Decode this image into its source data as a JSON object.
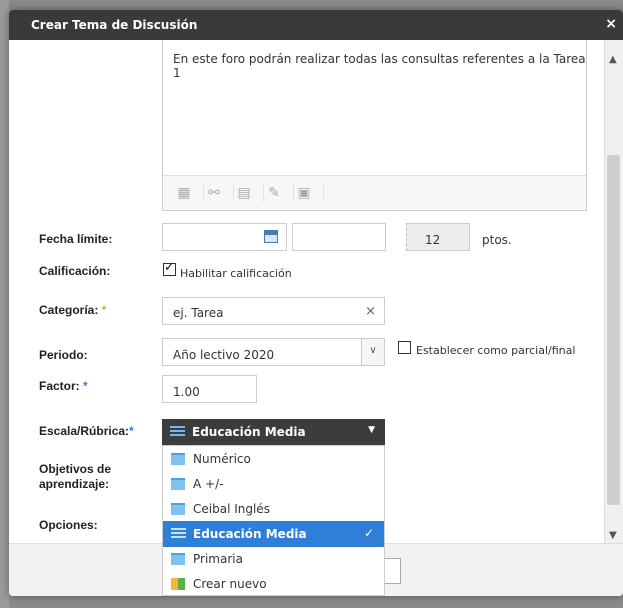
{
  "dialog": {
    "title": "Crear Tema de Discusión",
    "close_glyph": "×"
  },
  "editor": {
    "text": "En este foro podrán realizar todas las consultas referentes a la Tarea 1",
    "toolbar_icons": [
      "table-icon",
      "link-icon",
      "media-icon",
      "pen-icon",
      "embed-icon"
    ]
  },
  "form": {
    "fecha_limite": {
      "label": "Fecha límite:",
      "date_value": "",
      "time_value": "",
      "points_value": "12",
      "points_unit": "ptos."
    },
    "calificacion": {
      "label": "Calificación:",
      "checkbox_label": "Habilitar calificación",
      "checked": true
    },
    "categoria": {
      "label": "Categoría:",
      "required_mark": "*",
      "placeholder": "ej. Tarea",
      "clear_glyph": "×"
    },
    "periodo": {
      "label": "Periodo:",
      "value": "Año lectivo 2020",
      "parcial_label": "Establecer como parcial/final",
      "parcial_checked": false
    },
    "factor": {
      "label": "Factor:",
      "required_mark": "*",
      "value": "1.00"
    },
    "escala": {
      "label": "Escala/Rúbrica:",
      "required_mark": "*",
      "value": "Educación Media"
    },
    "objetivos": {
      "label": "Objetivos de aprendizaje:"
    },
    "opciones": {
      "label": "Opciones:"
    }
  },
  "dropdown": {
    "items": [
      {
        "label": "Numérico",
        "selected": false
      },
      {
        "label": "A +/-",
        "selected": false
      },
      {
        "label": "Ceibal Inglés",
        "selected": false
      },
      {
        "label": "Educación Media",
        "selected": true
      },
      {
        "label": "Primaria",
        "selected": false
      },
      {
        "label": "Crear nuevo",
        "selected": false
      }
    ]
  },
  "colors": {
    "titlebar": "#3a3a3a",
    "selected_item": "#2f7fd8",
    "required_orange": "#e8a33d",
    "required_blue": "#2a7ae2"
  }
}
